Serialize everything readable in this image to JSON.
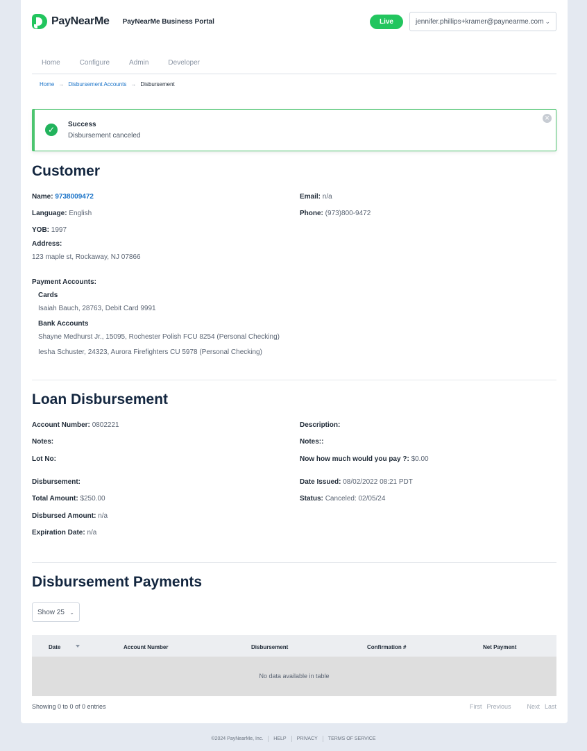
{
  "header": {
    "brand": "PayNearMe",
    "portal_title": "PayNearMe Business Portal",
    "live_label": "Live",
    "account_email": "jennifer.phillips+kramer@paynearme.com"
  },
  "nav": {
    "items": [
      "Home",
      "Configure",
      "Admin",
      "Developer"
    ]
  },
  "breadcrumb": {
    "home": "Home",
    "accounts": "Disbursement Accounts",
    "current": "Disbursement",
    "arrow": "→"
  },
  "alert": {
    "title": "Success",
    "message": "Disbursement canceled"
  },
  "customer": {
    "heading": "Customer",
    "name_label": "Name:",
    "name_value": "9738009472",
    "email_label": "Email:",
    "email_value": "n/a",
    "language_label": "Language:",
    "language_value": "English",
    "phone_label": "Phone:",
    "phone_value": "(973)800-9472",
    "yob_label": "YOB:",
    "yob_value": "1997",
    "address_label": "Address:",
    "address_value": "123 maple st,  Rockaway, NJ 07866",
    "payment_accounts_label": "Payment Accounts:",
    "cards_label": "Cards",
    "cards": [
      "Isaiah Bauch, 28763, Debit Card 9991"
    ],
    "bank_accounts_label": "Bank Accounts",
    "bank_accounts": [
      "Shayne Medhurst Jr., 15095, Rochester Polish FCU 8254 (Personal Checking)",
      "Iesha Schuster, 24323, Aurora Firefighters CU 5978 (Personal Checking)"
    ]
  },
  "loan": {
    "heading": "Loan Disbursement",
    "account_number_label": "Account Number:",
    "account_number_value": "0802221",
    "description_label": "Description:",
    "notes_label": "Notes:",
    "notes2_label": "Notes::",
    "lot_label": "Lot No:",
    "pay_label": "Now how much would you pay ?:",
    "pay_value": "$0.00",
    "disbursement_label": "Disbursement:",
    "date_issued_label": "Date Issued:",
    "date_issued_value": "08/02/2022 08:21 PDT",
    "total_label": "Total Amount:",
    "total_value": "$250.00",
    "status_label": "Status:",
    "status_value": "Canceled: 02/05/24",
    "disbursed_label": "Disbursed Amount:",
    "disbursed_value": "n/a",
    "expiration_label": "Expiration Date:",
    "expiration_value": "n/a"
  },
  "payments": {
    "heading": "Disbursement Payments",
    "show_label": "Show 25",
    "columns": [
      "Date",
      "Account Number",
      "Disbursement",
      "Confirmation #",
      "Net Payment"
    ],
    "empty_text": "No data available in table",
    "info": "Showing 0 to 0 of 0 entries",
    "pager": [
      "First",
      "Previous",
      "Next",
      "Last"
    ]
  },
  "footer": {
    "copyright": "©2024 PayNearMe, Inc.",
    "links": [
      "HELP",
      "PRIVACY",
      "TERMS OF SERVICE"
    ]
  },
  "colors": {
    "brand_green": "#22c55e",
    "link_blue": "#1a73c8",
    "heading_navy": "#13263f"
  }
}
